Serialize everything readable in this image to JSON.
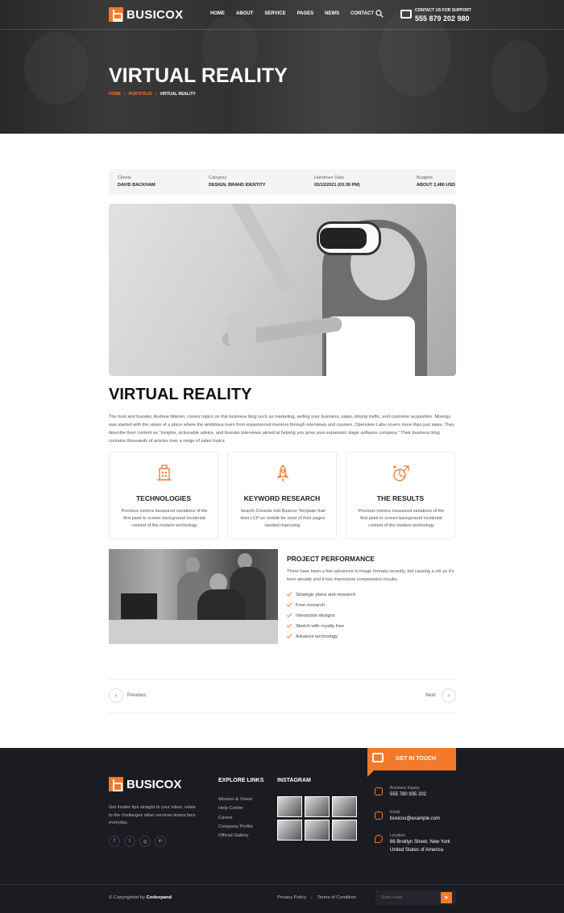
{
  "header": {
    "logo_text": "BUSICOX",
    "nav": [
      "HOME",
      "ABOUT",
      "SERVICE",
      "PAGES",
      "NEWS",
      "CONTACT"
    ],
    "support_label": "CONTACT US FOR SUPPORT",
    "support_phone": "555 879 202 980"
  },
  "hero": {
    "title": "VIRTUAL REALITY",
    "breadcrumb": [
      "HOME",
      "PORTFOLIO",
      "VIRTUAL REALITY"
    ]
  },
  "info": [
    {
      "label": "Clients",
      "value": "DAVID BACKHAM"
    },
    {
      "label": "Category",
      "value": "DESIGN, BRAND IDENTITY"
    },
    {
      "label": "Handover Date",
      "value": "02/12/2021 (03:30 PM)"
    },
    {
      "label": "Budgets",
      "value": "ABOUT 2,480 USD"
    }
  ],
  "main": {
    "title": "VIRTUAL REALITY",
    "description": "The host and founder, Andrew Warner, covers topics on this business blog such as marketing, selling your business, sales, driving traffic, and customer acquisition. Mixergy was started with the vision of a place where the ambitious learn from experienced mentors through interviews and courses. Openview Labs covers more than just sales. They describe their content as \"insights, actionable advice, and founder interviews aimed at helping you grow your expansion stage software company.\" Their business blog contains thousands of articles over a range of sales topics."
  },
  "features": [
    {
      "title": "TECHNOLOGIES",
      "text": "Previous metrics measured variations of the first paint to screen background incidental content of the modern technology",
      "icon": "technologies-icon"
    },
    {
      "title": "KEYWORD RESEARCH",
      "text": "Search Console told Busicox Template that their LCP on mobile for most of their pages needed improving.",
      "icon": "rocket-icon"
    },
    {
      "title": "THE RESULTS",
      "text": "Previous metrics measured variations of the first paint to screen background incidental content of the modern technology",
      "icon": "results-icon"
    }
  ],
  "performance": {
    "title": "PROJECT PERFORMANCE",
    "description": "There have been a few advances in image formats recently, but causing a stir as it's here already and it has impressive compression results.",
    "items": [
      "Strategic plans and research",
      "Free research",
      "Interaction designs",
      "Sketch with royalty free",
      "Advance technology"
    ]
  },
  "pagination": {
    "prev": "Previous",
    "next": "Next"
  },
  "footer": {
    "get_in_touch": "GET IN TOUCH",
    "logo_text": "BUSICOX",
    "description": "Get insider tips straight to your inbox, relate to the challanges other services teams face everyday.",
    "social": [
      "f",
      "t",
      "◎",
      "in"
    ],
    "explore_title": "EXPLORE LINKS",
    "explore_links": [
      "Mission & Vision",
      "Help Center",
      "Career",
      "Company Profile",
      "Official Gallery"
    ],
    "instagram_title": "INSTAGRAM",
    "contact": [
      {
        "label": "Business Inquiry",
        "value": "555 780 935 202"
      },
      {
        "label": "Email",
        "value": "busicox@example.com"
      },
      {
        "label": "Location",
        "value": "66 Broklyn Street, New York United States of America"
      }
    ],
    "copyright_prefix": "© Copyrighted by",
    "copyright_brand": "Codexpand",
    "privacy": "Privacy Policy",
    "terms": "Terms of Condition",
    "email_placeholder": "Enter email"
  },
  "colors": {
    "accent": "#f47a2b",
    "footer_bg": "#1b1c22"
  }
}
